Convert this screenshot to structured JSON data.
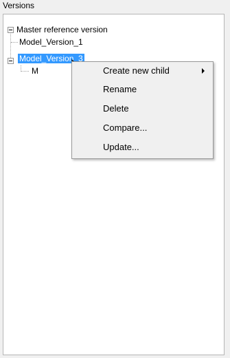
{
  "panel": {
    "title": "Versions"
  },
  "tree": {
    "root": {
      "label": "Master reference version",
      "expanded": true
    },
    "children": [
      {
        "label": "Model_Version_1"
      },
      {
        "label": "Model_Version_3",
        "selected": true,
        "expanded": true
      },
      {
        "label": "M"
      }
    ]
  },
  "context_menu": {
    "items": [
      {
        "label": "Create new child",
        "has_submenu": true
      },
      {
        "label": "Rename"
      },
      {
        "label": "Delete"
      },
      {
        "label": "Compare..."
      },
      {
        "label": "Update..."
      }
    ]
  },
  "icons": {
    "collapse": "collapse-minus-icon",
    "submenu": "submenu-arrow-icon",
    "cursor": "mouse-pointer-icon"
  },
  "colors": {
    "selection_bg": "#3399ff",
    "selection_text": "#ffffff"
  }
}
